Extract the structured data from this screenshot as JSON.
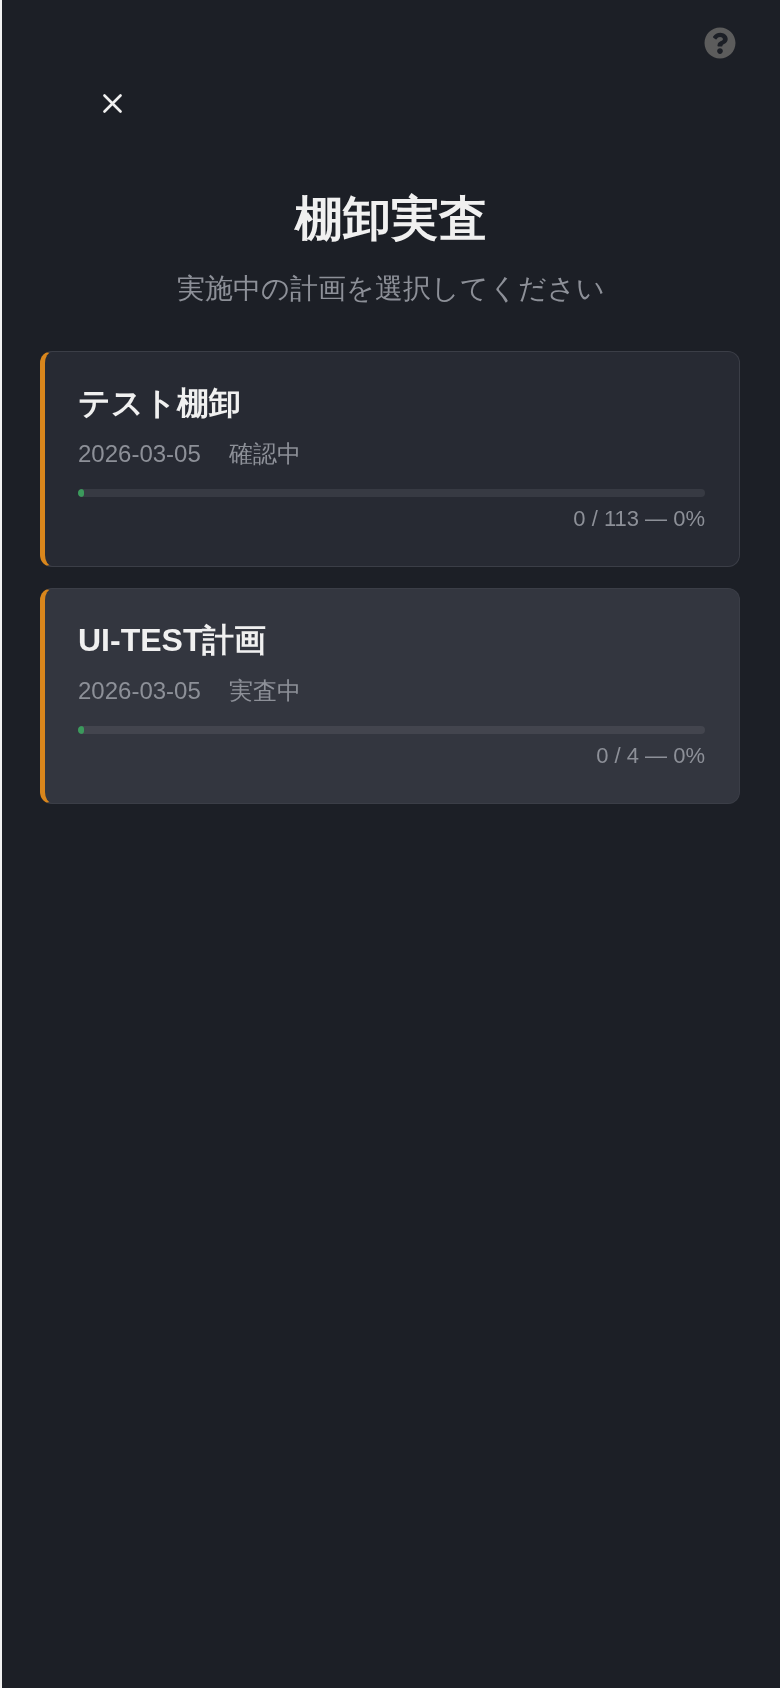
{
  "header": {
    "title": "棚卸実査",
    "subtitle": "実施中の計画を選択してください"
  },
  "plans": [
    {
      "name": "テスト棚卸",
      "date": "2026-03-05",
      "status": "確認中",
      "level": 0,
      "progress": "0 / 113 — 0%",
      "selected": false
    },
    {
      "name": "UI-TEST計画",
      "date": "2026-03-05",
      "status": "実査中",
      "level": 0,
      "progress": "0 / 4 — 0%",
      "selected": true
    }
  ]
}
